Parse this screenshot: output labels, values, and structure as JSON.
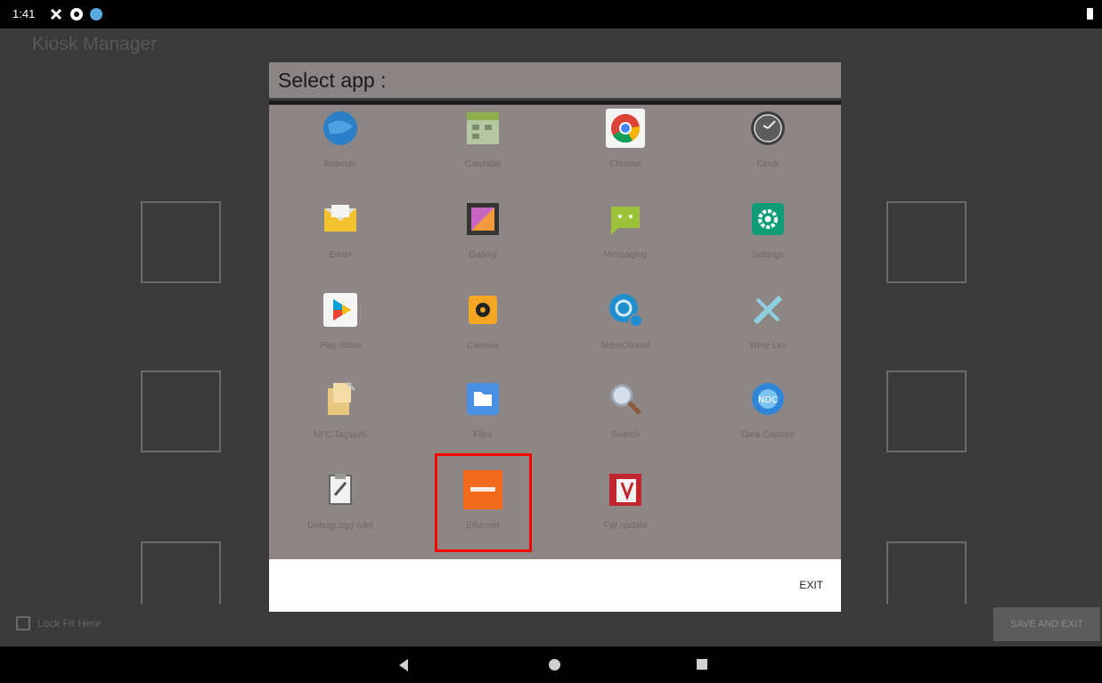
{
  "status_bar": {
    "time": "1:41"
  },
  "app_title": "Kiosk Manager",
  "dialog": {
    "title": "Select app :",
    "exit_label": "EXIT",
    "apps": [
      {
        "label": "Browser",
        "icon": "globe-icon"
      },
      {
        "label": "Calendar",
        "icon": "calendar-icon"
      },
      {
        "label": "Chrome",
        "icon": "chrome-icon"
      },
      {
        "label": "Clock",
        "icon": "clock-icon"
      },
      {
        "label": "Email",
        "icon": "email-icon"
      },
      {
        "label": "Gallery",
        "icon": "gallery-icon"
      },
      {
        "label": "Messaging",
        "icon": "messaging-icon"
      },
      {
        "label": "Settings",
        "icon": "gear-icon"
      },
      {
        "label": "Play Store",
        "icon": "play-store-icon"
      },
      {
        "label": "Camera",
        "icon": "camera-icon"
      },
      {
        "label": "MdmControl",
        "icon": "mdm-icon"
      },
      {
        "label": "Write Lkn",
        "icon": "tools-icon"
      },
      {
        "label": "NFC Tagsinfo",
        "icon": "nfc-icon"
      },
      {
        "label": "Files",
        "icon": "folder-icon"
      },
      {
        "label": "Search",
        "icon": "search-icon"
      },
      {
        "label": "Data Capture",
        "icon": "data-capture-icon"
      },
      {
        "label": "DebugLogg erkit",
        "icon": "debug-icon"
      },
      {
        "label": "Ethernet",
        "icon": "ethernet-icon"
      },
      {
        "label": "FW update",
        "icon": "fw-update-icon"
      }
    ]
  },
  "lock_label": "Lock Fit Here",
  "save_button": "SAVE AND EXIT",
  "colors": {
    "title_bar": "#8a8584",
    "grid_bg": "#8d8685",
    "highlight": "#ff0000"
  }
}
